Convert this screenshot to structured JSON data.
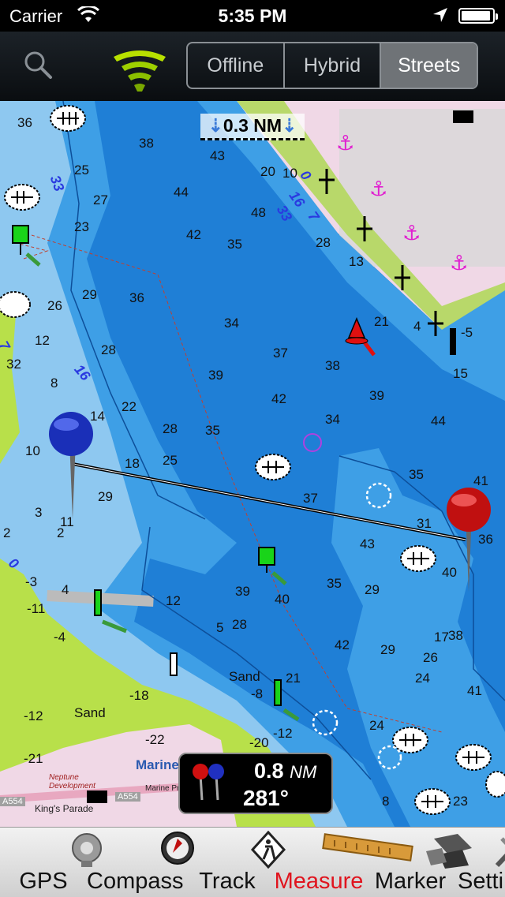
{
  "status_bar": {
    "carrier": "Carrier",
    "time": "5:35 PM"
  },
  "toolbar": {
    "map_modes": [
      {
        "label": "Offline",
        "active": false
      },
      {
        "label": "Hybrid",
        "active": false
      },
      {
        "label": "Streets",
        "active": true
      }
    ]
  },
  "map": {
    "scale_label": "0.3 NM",
    "depth_soundings": [
      "36",
      "38",
      "43",
      "25",
      "27",
      "23",
      "29",
      "26",
      "12",
      "8",
      "32",
      "10",
      "14",
      "22",
      "28",
      "18",
      "25",
      "28",
      "29",
      "35",
      "39",
      "36",
      "34",
      "42",
      "44",
      "48",
      "35",
      "20",
      "10",
      "28",
      "13",
      "21",
      "4",
      "-5",
      "15",
      "37",
      "38",
      "39",
      "34",
      "44",
      "42",
      "35",
      "41",
      "37",
      "31",
      "36",
      "43",
      "40",
      "29",
      "35",
      "39",
      "40",
      "12",
      "5",
      "28",
      "42",
      "29",
      "26",
      "24",
      "17",
      "38",
      "41",
      "21",
      "-8",
      "-12",
      "24",
      "-20",
      "-22",
      "-18",
      "-12",
      "-21",
      "-3",
      "-11",
      "-4",
      "4",
      "2",
      "3",
      "11",
      "2",
      "23",
      "8",
      "Sand",
      "Sand"
    ],
    "contour_labels": [
      "33",
      "16",
      "7",
      "0",
      "33",
      "16",
      "7",
      "0"
    ],
    "place_labels": [
      "Marine",
      "Neptune Development",
      "A554",
      "King's Parade",
      "A554",
      "Marine Pr"
    ]
  },
  "measure": {
    "distance_value": "0.8",
    "distance_unit": "NM",
    "bearing": "281°"
  },
  "tabs": [
    {
      "label": "GPS",
      "icon": "gps-dish-icon",
      "active": false
    },
    {
      "label": "Compass",
      "icon": "compass-icon",
      "active": false
    },
    {
      "label": "Track",
      "icon": "track-sign-icon",
      "active": false
    },
    {
      "label": "Measure",
      "icon": "ruler-icon",
      "active": true
    },
    {
      "label": "Marker",
      "icon": "marker-icon",
      "active": false
    },
    {
      "label": "Setti",
      "icon": "settings-tools-icon",
      "active": false
    }
  ],
  "colors": {
    "deep_water": "#1f7fd6",
    "mid_water": "#3e9fe6",
    "shallow_water": "#8ec8f0",
    "land": "#b8e04a",
    "urban": "#f0d8e6",
    "active_tab": "#e0141e"
  }
}
